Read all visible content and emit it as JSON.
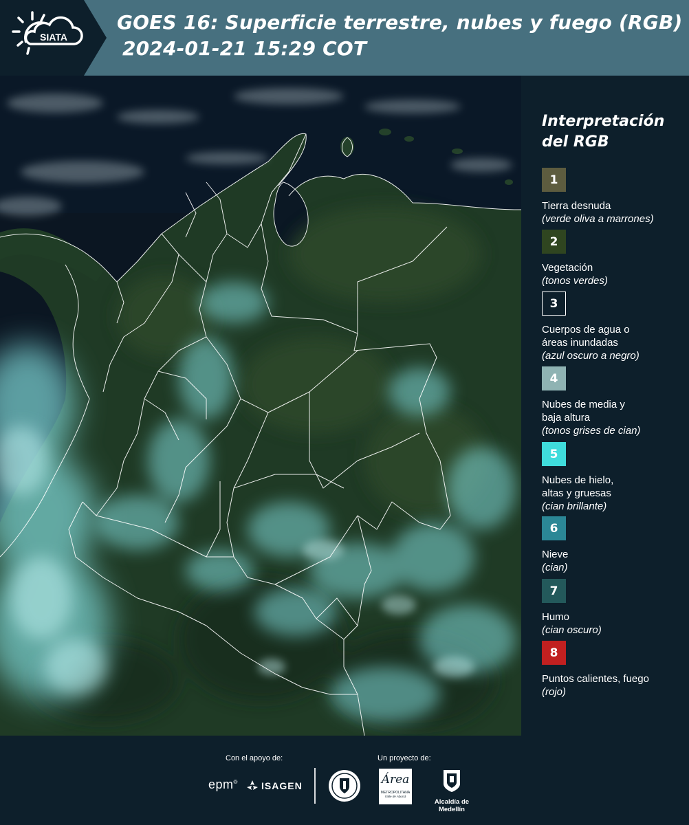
{
  "header": {
    "logo_text": "SIATA",
    "title_line1": "GOES 16: Superficie terrestre, nubes y fuego (RGB)",
    "title_line2": "2024-01-21 15:29 COT",
    "background_color": "#47707f"
  },
  "legend": {
    "title": "Interpretación del RGB",
    "items": [
      {
        "number": "1",
        "label": "Tierra desnuda",
        "sub": "(verde oliva a marrones)",
        "color": "#5d5c3f"
      },
      {
        "number": "2",
        "label": "Vegetación",
        "sub": "(tonos verdes)",
        "color": "#2f4520"
      },
      {
        "number": "3",
        "label": "Cuerpos de agua o\náreas inundadas",
        "sub": "(azul oscuro a negro)",
        "color": "#0d1f2b"
      },
      {
        "number": "4",
        "label": "Nubes de media y\nbaja altura",
        "sub": "(tonos grises de cian)",
        "color": "#8fb3b3"
      },
      {
        "number": "5",
        "label": "Nubes de hielo,\naltas y gruesas",
        "sub": "(cian brillante)",
        "color": "#3fdcdc"
      },
      {
        "number": "6",
        "label": "Nieve",
        "sub": "(cian)",
        "color": "#2b8796"
      },
      {
        "number": "7",
        "label": "Humo",
        "sub": "(cian oscuro)",
        "color": "#23595b"
      },
      {
        "number": "8",
        "label": "Puntos calientes, fuego",
        "sub": "(rojo)",
        "color": "#c12020"
      }
    ]
  },
  "footer": {
    "support_label": "Con el apoyo de:",
    "project_label": "Un proyecto de:",
    "partners": {
      "epm": "epm",
      "isagen": "ISAGEN",
      "area_metro": "Área",
      "area_metro_sub": "METROPOLITANA",
      "area_metro_sub2": "Valle de Aburrá",
      "alcaldia": "Alcaldía de Medellín"
    }
  },
  "map": {
    "colors": {
      "ocean": "#0b1622",
      "caribbean": "#0a1a2c",
      "land": "#1f3a25",
      "land_light": "#2e4a2c",
      "cloud": "#7fd8d8",
      "border": "#ffffff"
    }
  }
}
